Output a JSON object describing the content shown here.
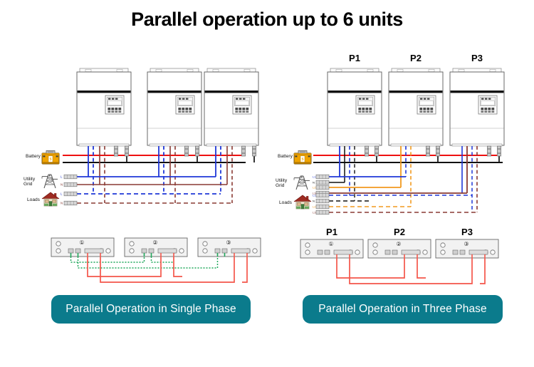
{
  "title": "Parallel operation up to 6 units",
  "captions": {
    "left": "Parallel Operation in Single Phase",
    "right": "Parallel Operation in Three Phase"
  },
  "colors": {
    "caption_bg": "#0b7b8c",
    "caption_text": "#ffffff",
    "title_text": "#000000",
    "background": "#ffffff",
    "wire_battery_positive": "#ee1111",
    "wire_battery_negative": "#111111",
    "wire_line_blue": "#1f37d8",
    "wire_line_brown": "#8a3a33",
    "wire_line_orange": "#f29a1f",
    "comm_cable_green": "#1fa85a",
    "comm_cable_red": "#f4564a",
    "inverter_body": "#ffffff",
    "inverter_outline": "#5a5a5a",
    "inverter_band": "#111111",
    "panel_fill": "#f2f2f2",
    "panel_outline": "#666666",
    "battery_icon": "#f0a400",
    "house_roof": "#9e2b22",
    "pylon": "#555555"
  },
  "left_diagram": {
    "name": "single-phase",
    "unit_count": 3,
    "units": [
      {
        "id": "unit-1",
        "label": ""
      },
      {
        "id": "unit-2",
        "label": ""
      },
      {
        "id": "unit-3",
        "label": ""
      }
    ],
    "source_labels": [
      {
        "key": "battery",
        "text": "Battery",
        "icon": "battery-icon"
      },
      {
        "key": "utility_grid",
        "text": "Utility\nGrid",
        "line1": "Utility",
        "line2": "Grid",
        "icon": "pylon-icon"
      },
      {
        "key": "loads",
        "text": "Loads",
        "icon": "house-icon"
      }
    ],
    "panels": [
      {
        "number": "①"
      },
      {
        "number": "②"
      },
      {
        "number": "③"
      }
    ],
    "comm_cables": [
      "green-dotted",
      "red-solid"
    ]
  },
  "right_diagram": {
    "name": "three-phase",
    "unit_count": 3,
    "units": [
      {
        "id": "unit-p1",
        "label": "P1"
      },
      {
        "id": "unit-p2",
        "label": "P2"
      },
      {
        "id": "unit-p3",
        "label": "P3"
      }
    ],
    "source_labels": [
      {
        "key": "battery",
        "text": "Battery",
        "icon": "battery-icon"
      },
      {
        "key": "utility_grid",
        "text": "Utility\nGrid",
        "line1": "Utility",
        "line2": "Grid",
        "icon": "pylon-icon"
      },
      {
        "key": "loads",
        "text": "Loads",
        "icon": "house-icon"
      }
    ],
    "panel_titles": [
      "P1",
      "P2",
      "P3"
    ],
    "panels": [
      {
        "number": "①",
        "title": "P1"
      },
      {
        "number": "②",
        "title": "P2"
      },
      {
        "number": "③",
        "title": "P3"
      }
    ],
    "comm_cables": [
      "red-solid"
    ]
  }
}
